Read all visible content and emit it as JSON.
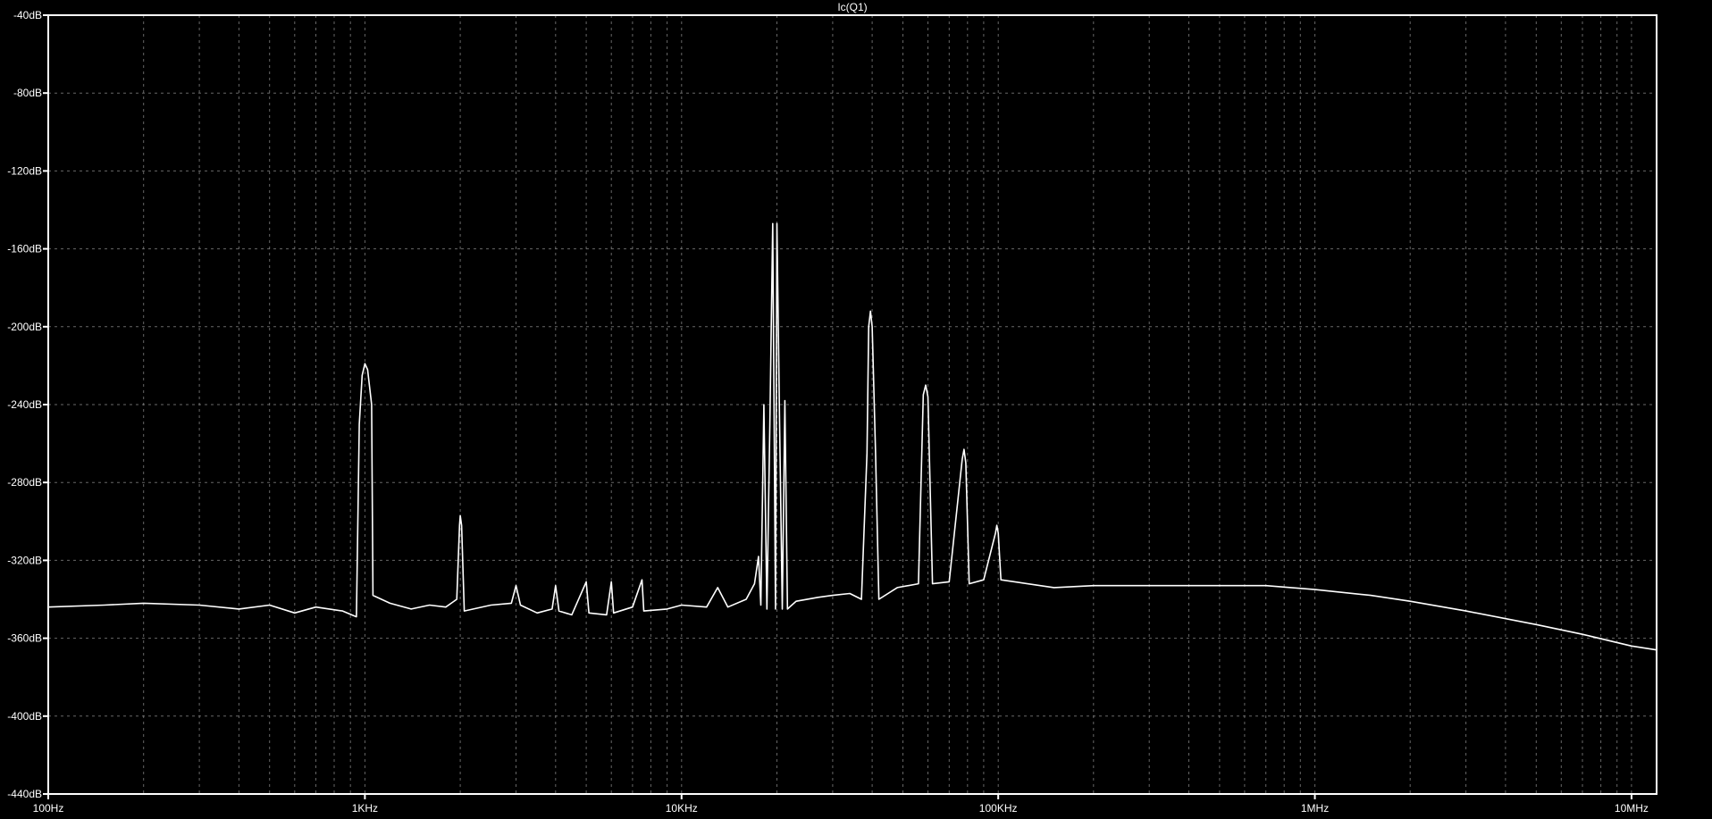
{
  "chart_data": {
    "type": "line",
    "title": "Ic(Q1)",
    "xlabel": "",
    "ylabel": "",
    "x_scale": "log",
    "xlim": [
      100,
      12000000
    ],
    "ylim": [
      -440,
      -40
    ],
    "grid": true,
    "y_ticks": [
      {
        "value": -40,
        "label": "-40dB"
      },
      {
        "value": -80,
        "label": "-80dB"
      },
      {
        "value": -120,
        "label": "-120dB"
      },
      {
        "value": -160,
        "label": "-160dB"
      },
      {
        "value": -200,
        "label": "-200dB"
      },
      {
        "value": -240,
        "label": "-240dB"
      },
      {
        "value": -280,
        "label": "-280dB"
      },
      {
        "value": -320,
        "label": "-320dB"
      },
      {
        "value": -360,
        "label": "-360dB"
      },
      {
        "value": -400,
        "label": "-400dB"
      },
      {
        "value": -440,
        "label": "-440dB"
      }
    ],
    "x_ticks": [
      {
        "value": 100,
        "label": "100Hz"
      },
      {
        "value": 1000,
        "label": "1KHz"
      },
      {
        "value": 10000,
        "label": "10KHz"
      },
      {
        "value": 100000,
        "label": "100KHz"
      },
      {
        "value": 1000000,
        "label": "1MHz"
      },
      {
        "value": 10000000,
        "label": "10MHz"
      }
    ],
    "series": [
      {
        "color": "#ffffff",
        "points": [
          [
            100,
            -344
          ],
          [
            150,
            -343
          ],
          [
            200,
            -342
          ],
          [
            300,
            -343
          ],
          [
            400,
            -345
          ],
          [
            500,
            -343
          ],
          [
            600,
            -347
          ],
          [
            700,
            -344
          ],
          [
            850,
            -346
          ],
          [
            940,
            -349
          ],
          [
            960,
            -250
          ],
          [
            980,
            -225
          ],
          [
            1000,
            -219
          ],
          [
            1020,
            -222
          ],
          [
            1050,
            -240
          ],
          [
            1060,
            -338
          ],
          [
            1200,
            -342
          ],
          [
            1400,
            -345
          ],
          [
            1600,
            -343
          ],
          [
            1800,
            -344
          ],
          [
            1950,
            -340
          ],
          [
            1990,
            -302
          ],
          [
            2000,
            -297
          ],
          [
            2020,
            -302
          ],
          [
            2060,
            -346
          ],
          [
            2200,
            -345
          ],
          [
            2500,
            -343
          ],
          [
            2900,
            -342
          ],
          [
            3000,
            -333
          ],
          [
            3100,
            -343
          ],
          [
            3500,
            -347
          ],
          [
            3900,
            -345
          ],
          [
            4000,
            -333
          ],
          [
            4100,
            -346
          ],
          [
            4500,
            -348
          ],
          [
            5000,
            -331
          ],
          [
            5100,
            -347
          ],
          [
            5800,
            -348
          ],
          [
            6000,
            -331
          ],
          [
            6100,
            -347
          ],
          [
            7000,
            -344
          ],
          [
            7500,
            -330
          ],
          [
            7600,
            -346
          ],
          [
            9000,
            -345
          ],
          [
            10000,
            -343
          ],
          [
            12000,
            -344
          ],
          [
            13000,
            -334
          ],
          [
            14000,
            -344
          ],
          [
            16000,
            -340
          ],
          [
            17000,
            -332
          ],
          [
            17500,
            -318
          ],
          [
            17800,
            -343
          ],
          [
            18200,
            -240
          ],
          [
            18600,
            -345
          ],
          [
            19000,
            -250
          ],
          [
            19400,
            -147
          ],
          [
            19800,
            -345
          ],
          [
            20000,
            -147
          ],
          [
            20400,
            -250
          ],
          [
            20800,
            -345
          ],
          [
            21200,
            -238
          ],
          [
            21600,
            -345
          ],
          [
            23000,
            -341
          ],
          [
            27000,
            -339
          ],
          [
            30000,
            -338
          ],
          [
            34000,
            -337
          ],
          [
            37000,
            -340
          ],
          [
            38500,
            -265
          ],
          [
            39000,
            -200
          ],
          [
            39500,
            -192
          ],
          [
            40000,
            -200
          ],
          [
            41000,
            -265
          ],
          [
            42000,
            -340
          ],
          [
            48000,
            -334
          ],
          [
            56000,
            -332
          ],
          [
            58000,
            -235
          ],
          [
            59000,
            -230
          ],
          [
            60000,
            -236
          ],
          [
            62000,
            -332
          ],
          [
            70000,
            -331
          ],
          [
            77000,
            -268
          ],
          [
            78000,
            -263
          ],
          [
            79000,
            -270
          ],
          [
            81000,
            -332
          ],
          [
            90000,
            -330
          ],
          [
            98000,
            -306
          ],
          [
            99000,
            -302
          ],
          [
            100000,
            -306
          ],
          [
            102000,
            -330
          ],
          [
            150000,
            -334
          ],
          [
            200000,
            -333
          ],
          [
            300000,
            -333
          ],
          [
            500000,
            -333
          ],
          [
            700000,
            -333
          ],
          [
            1000000,
            -335
          ],
          [
            1500000,
            -338
          ],
          [
            2000000,
            -341
          ],
          [
            3000000,
            -346
          ],
          [
            5000000,
            -353
          ],
          [
            7000000,
            -358
          ],
          [
            10000000,
            -364
          ],
          [
            12000000,
            -366
          ]
        ]
      }
    ]
  }
}
